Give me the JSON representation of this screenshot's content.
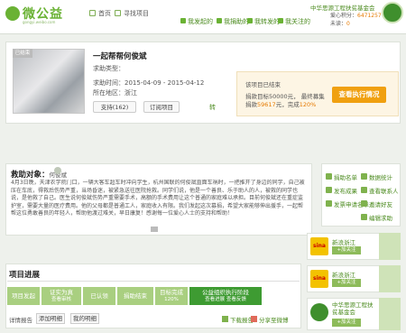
{
  "header": {
    "logo_text": "微公益",
    "logo_sub": "gongyi.weibo.com",
    "nav": [
      {
        "label": "首页",
        "icon": "home-icon"
      },
      {
        "label": "寻找项目",
        "icon": "search-icon"
      }
    ],
    "subnav": [
      {
        "label": "我发起的",
        "icon": "list-icon"
      },
      {
        "label": "我捐助的",
        "icon": "gift-icon"
      },
      {
        "label": "我转发的",
        "icon": "share-icon"
      },
      {
        "label": "我关注的",
        "icon": "star-icon"
      }
    ],
    "org_name": "中华思源工程扶贫基金会",
    "love_points_label": "爱心积分：",
    "love_points_value": "6471257",
    "unread_label": "未读：",
    "unread_value": "0"
  },
  "project": {
    "title": "一起帮帮何俊斌",
    "photo_tag": "已结束",
    "type_label": "求助类型：",
    "time_label": "求助时间：",
    "time_value": "2015-04-09 - 2015-04-12",
    "location_label": "所在地区：",
    "location_value": "浙江",
    "support_label": "支持(162)",
    "follow_label": "订阅项目",
    "share_label": "转",
    "ended_text": "该项目已结束",
    "goal_text": "捐款目标50000元，  最终募集",
    "raised_prefix": "捐款",
    "raised_value": "59617",
    "raised_mid": "元，完成",
    "complete_value": "120%",
    "report_button": "查看执行情况"
  },
  "sidebar": {
    "links": [
      {
        "label": "捐助名单",
        "icon": "people-icon"
      },
      {
        "label": "数据统计",
        "icon": "chart-icon"
      },
      {
        "label": "发布成果",
        "icon": "doc-icon"
      },
      {
        "label": "查看联系人",
        "icon": "contact-icon"
      },
      {
        "label": "发票申请名单",
        "icon": "receipt-icon"
      },
      {
        "label": "邀请好友",
        "icon": "invite-icon"
      },
      {
        "label": "编辑求助",
        "icon": "edit-icon"
      }
    ],
    "cards": [
      {
        "title": "新浪浙江",
        "follow": "+加关注",
        "logo": "sina-logo"
      },
      {
        "title": "新浪浙江",
        "follow": "+加关注",
        "logo": "sina-logo"
      },
      {
        "title": "中华思源工程扶贫基金会",
        "follow": "+加关注",
        "logo": "foundation-logo"
      }
    ]
  },
  "help": {
    "heading": "救助对象：",
    "heading_name": "何俊斌",
    "body": "4月3日晚，天津农学院门口，一辆大客车超车时冲向学生，杭州国联的何俊斌直面车祸时，一把推开了身边的同学，自己被压在车底，得救后伤势严重，当场昏迷，被紧急送往医院抢救。同学们说，他是一个善良、乐于助人的人，被救的同学也说，是他救了自己。医生说何俊斌伤势严重需要手术，高额的手术费用让这个普通的家庭难以承担。目前何俊斌还在重症监护室，需要大量的医疗费用。他的父母都是普通工人，家庭收入有限。我们发起这次募捐，希望大家能够伸出援手，一起帮帮这位勇敢善良的年轻人，帮助他渡过难关，早日康复！感谢每一位爱心人士的支持和帮助！"
  },
  "progress": {
    "heading": "项目进展",
    "steps": [
      {
        "label": "项目发起",
        "sub": ""
      },
      {
        "label": "证实为真",
        "sub": "查看审核"
      },
      {
        "label": "已认领",
        "sub": ""
      },
      {
        "label": "捐助结束",
        "sub": ""
      },
      {
        "label": "目标完成",
        "sub": "120%"
      },
      {
        "label": "公益组织执行阶段",
        "sub": "查看进展  查看反馈"
      }
    ],
    "detail_label": "详情报告",
    "add_button": "添加明细",
    "my_button": "我的明细",
    "download_label": "下载报告",
    "share_label": "分享至微博"
  },
  "colors": {
    "brand_green": "#6ab234",
    "report_orange": "#f0a010",
    "step_green": "#8dbb5a",
    "step_active": "#3e9b32"
  }
}
